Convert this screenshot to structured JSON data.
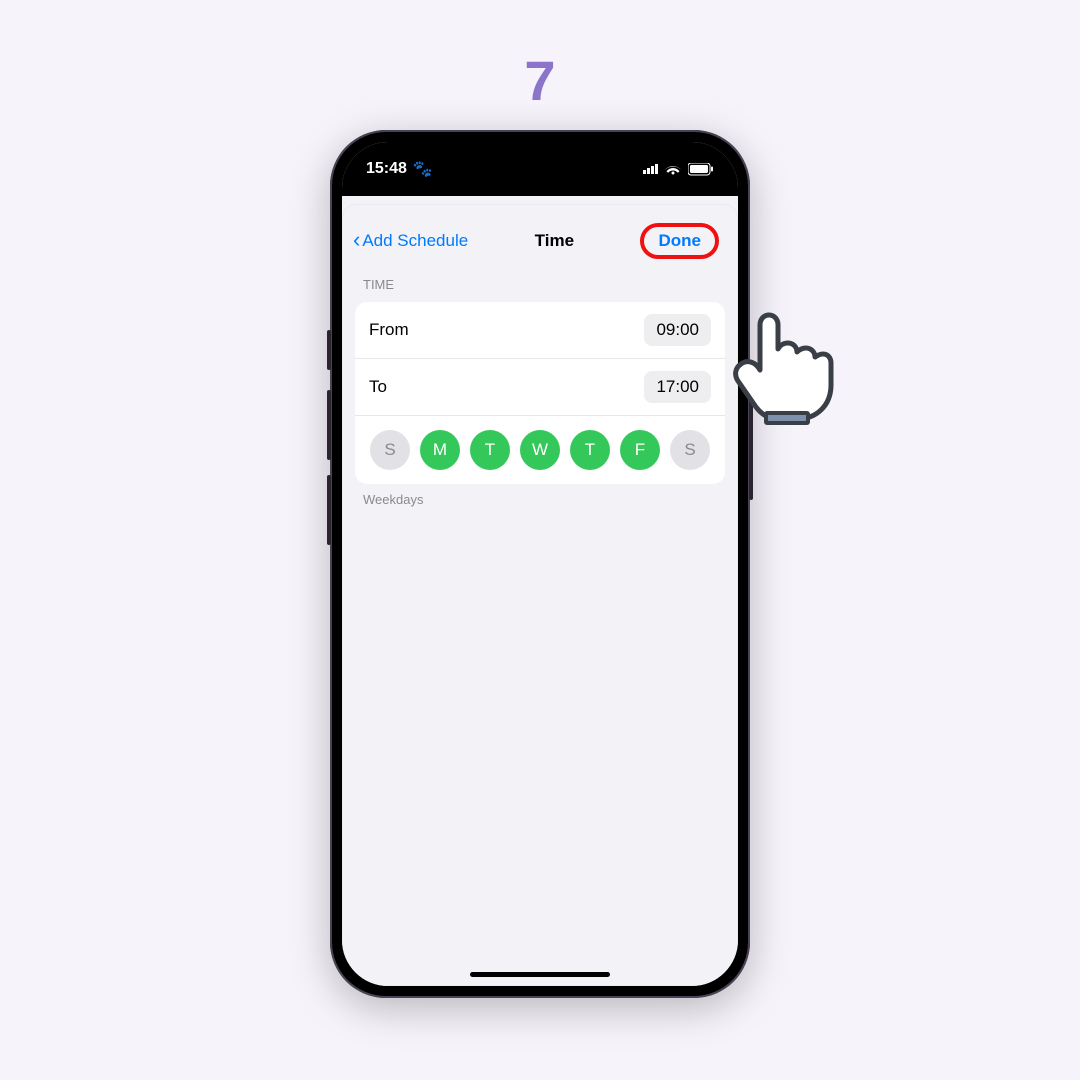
{
  "step": "7",
  "colors": {
    "accent_purple": "#8c74cb",
    "ios_blue": "#007aff",
    "green": "#34c759",
    "highlight_red": "#e11"
  },
  "statusbar": {
    "time": "15:48",
    "paw": "🐾"
  },
  "nav": {
    "back_label": "Add Schedule",
    "title": "Time",
    "done_label": "Done"
  },
  "section": {
    "header": "TIME",
    "caption": "Weekdays"
  },
  "time": {
    "from_label": "From",
    "from_value": "09:00",
    "to_label": "To",
    "to_value": "17:00"
  },
  "days": [
    {
      "letter": "S",
      "selected": false
    },
    {
      "letter": "M",
      "selected": true
    },
    {
      "letter": "T",
      "selected": true
    },
    {
      "letter": "W",
      "selected": true
    },
    {
      "letter": "T",
      "selected": true
    },
    {
      "letter": "F",
      "selected": true
    },
    {
      "letter": "S",
      "selected": false
    }
  ]
}
